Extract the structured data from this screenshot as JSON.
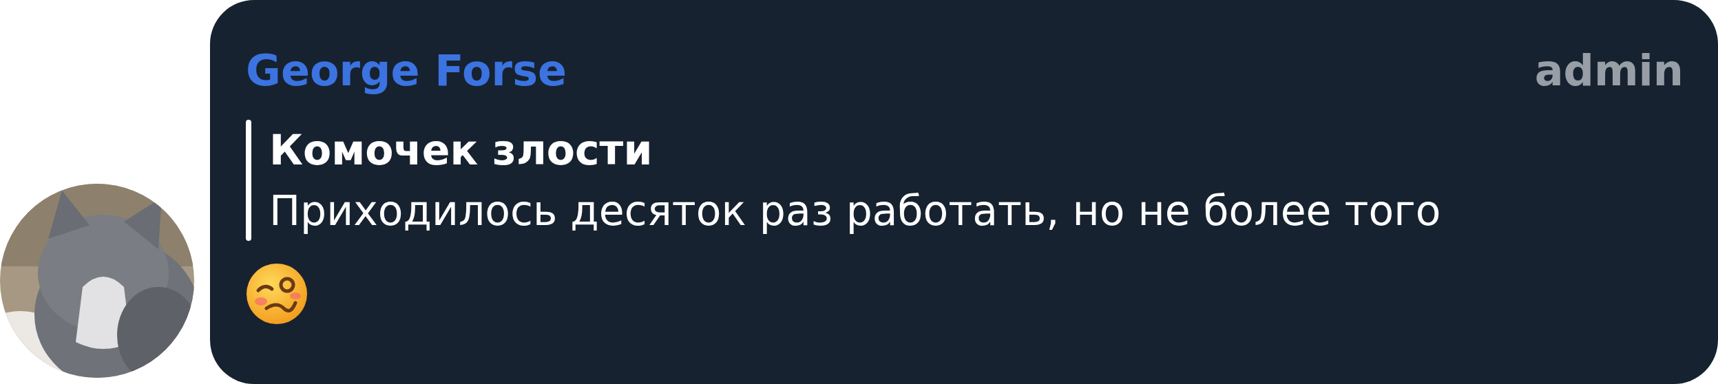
{
  "message": {
    "author": "George Forse",
    "role": "admin",
    "quote": {
      "title": "Комочек злости",
      "text": "Приходилось десяток раз работать, но не более того"
    }
  }
}
